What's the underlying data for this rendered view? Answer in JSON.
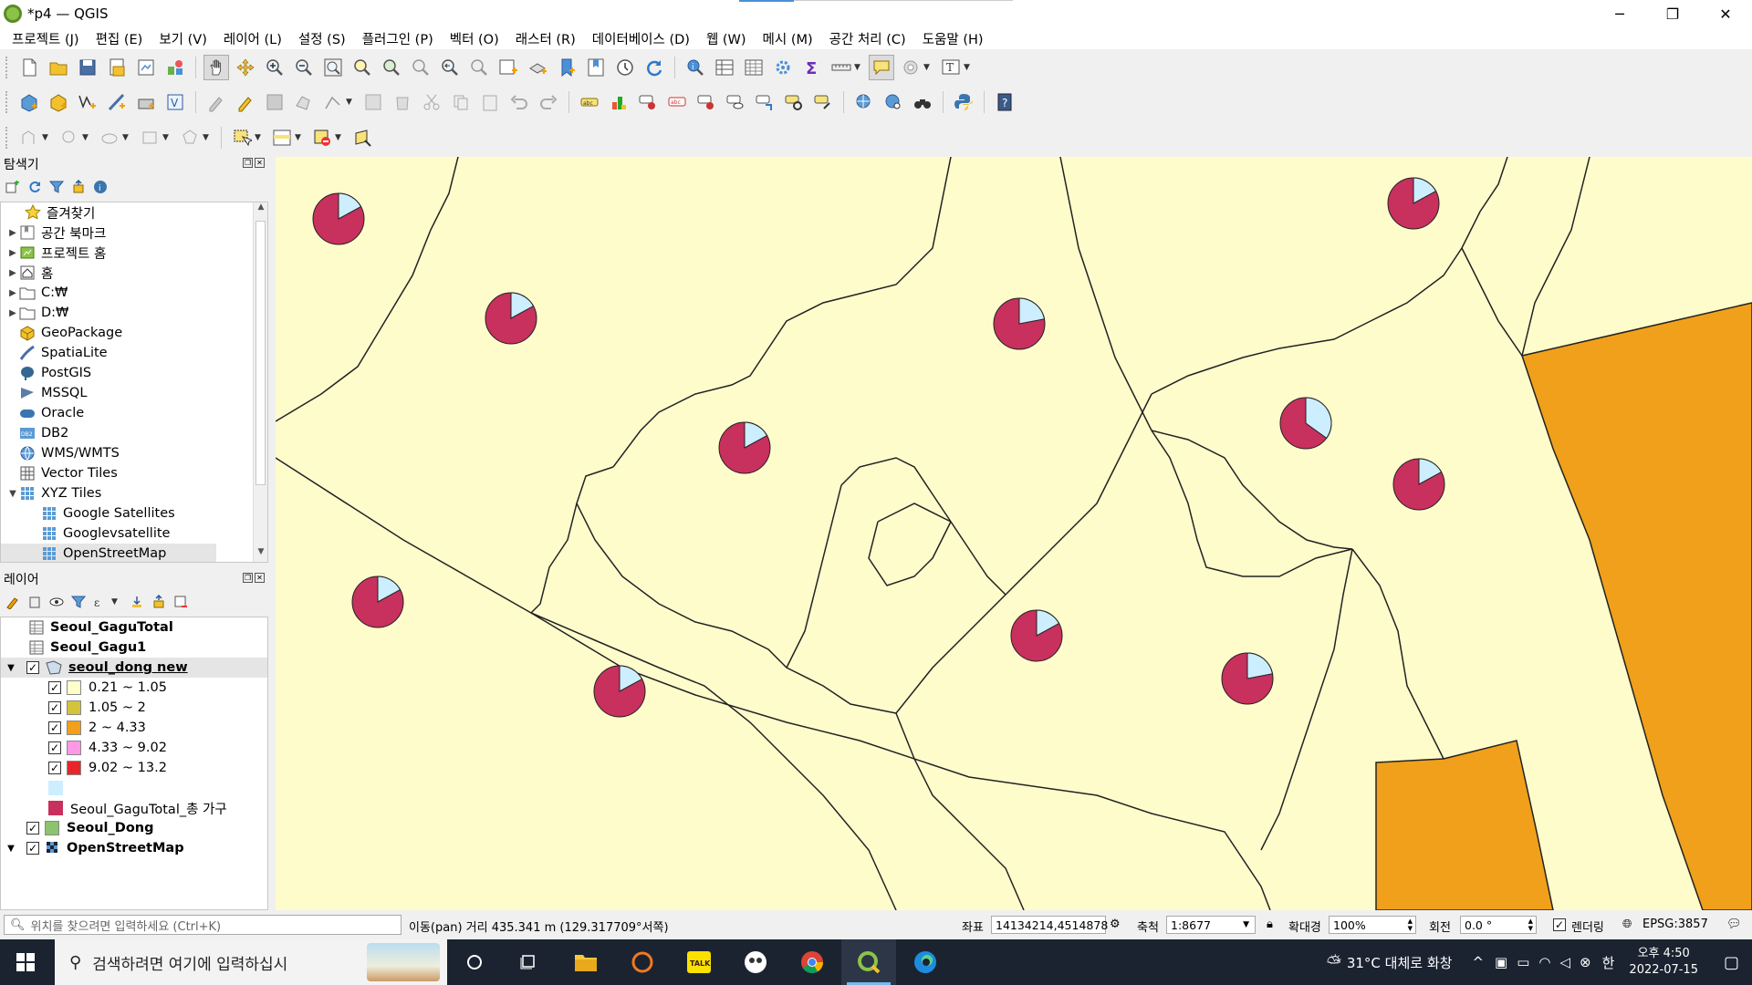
{
  "window": {
    "title": "*p4 — QGIS",
    "minimize": "─",
    "maximize": "❐",
    "close": "✕"
  },
  "menu": [
    "프로젝트 (J)",
    "편집 (E)",
    "보기 (V)",
    "레이어 (L)",
    "설정 (S)",
    "플러그인 (P)",
    "벡터 (O)",
    "래스터 (R)",
    "데이터베이스 (D)",
    "웹 (W)",
    "메시 (M)",
    "공간 처리 (C)",
    "도움말 (H)"
  ],
  "browser_panel": {
    "title": "탐색기",
    "items": [
      {
        "label": "즐겨찾기",
        "icon": "star-icon",
        "arrow": ""
      },
      {
        "label": "공간 북마크",
        "icon": "bookmark-icon",
        "arrow": "▶"
      },
      {
        "label": "프로젝트 홈",
        "icon": "project-home-icon",
        "arrow": "▶"
      },
      {
        "label": "홈",
        "icon": "home-icon",
        "arrow": "▶"
      },
      {
        "label": "C:₩",
        "icon": "folder-icon",
        "arrow": "▶"
      },
      {
        "label": "D:₩",
        "icon": "folder-icon",
        "arrow": "▶"
      },
      {
        "label": "GeoPackage",
        "icon": "geopackage-icon",
        "arrow": ""
      },
      {
        "label": "SpatiaLite",
        "icon": "spatialite-icon",
        "arrow": ""
      },
      {
        "label": "PostGIS",
        "icon": "postgis-icon",
        "arrow": ""
      },
      {
        "label": "MSSQL",
        "icon": "mssql-icon",
        "arrow": ""
      },
      {
        "label": "Oracle",
        "icon": "oracle-icon",
        "arrow": ""
      },
      {
        "label": "DB2",
        "icon": "db2-icon",
        "arrow": ""
      },
      {
        "label": "WMS/WMTS",
        "icon": "wms-icon",
        "arrow": ""
      },
      {
        "label": "Vector Tiles",
        "icon": "vector-tiles-icon",
        "arrow": ""
      },
      {
        "label": "XYZ Tiles",
        "icon": "xyz-tiles-icon",
        "arrow": "▼"
      },
      {
        "label": "Google Satellites",
        "icon": "xyz-tile-icon",
        "arrow": "",
        "child": true
      },
      {
        "label": "Googlevsatellite",
        "icon": "xyz-tile-icon",
        "arrow": "",
        "child": true
      },
      {
        "label": "OpenStreetMap",
        "icon": "xyz-tile-icon",
        "arrow": "",
        "child": true,
        "selected": true
      }
    ]
  },
  "layers_panel": {
    "title": "레이어",
    "layers": [
      {
        "label": "Seoul_GaguTotal",
        "type": "table",
        "checked": null,
        "bold": true
      },
      {
        "label": "Seoul_Gagu1",
        "type": "table",
        "checked": null,
        "bold": true
      },
      {
        "label": "seoul_dong new",
        "type": "polygon",
        "checked": true,
        "bold": true,
        "underline": true,
        "expanded": true
      },
      {
        "label": "0.21 ~ 1.05",
        "type": "class",
        "checked": true,
        "color": "#ffffcc"
      },
      {
        "label": "1.05 ~ 2",
        "type": "class",
        "checked": true,
        "color": "#d4c33a"
      },
      {
        "label": "2 ~ 4.33",
        "type": "class",
        "checked": true,
        "color": "#f0a01a"
      },
      {
        "label": "4.33 ~ 9.02",
        "type": "class",
        "checked": true,
        "color": "#ff99e6"
      },
      {
        "label": "9.02 ~ 13.2",
        "type": "class",
        "checked": true,
        "color": "#e8262a"
      },
      {
        "label": "",
        "type": "diagram",
        "color": "#cceeff"
      },
      {
        "label": "Seoul_GaguTotal_총 가구",
        "type": "diagram",
        "color": "#c8305e"
      },
      {
        "label": "Seoul_Dong",
        "type": "polygon",
        "checked": true,
        "bold": true,
        "color": "#8dc26f"
      },
      {
        "label": "OpenStreetMap",
        "type": "raster",
        "checked": true,
        "bold": true
      }
    ]
  },
  "map": {
    "pie_colors": {
      "main": "#c8305e",
      "secondary": "#cceeff"
    },
    "fill_light": "#fffccc",
    "fill_orange": "#f0a01a"
  },
  "statusbar": {
    "locator_placeholder": "위치를 찾으려면 입력하세요 (Ctrl+K)",
    "message": "이동(pan) 거리 435.341 m (129.317709°서쪽)",
    "coord_label": "좌표",
    "coord_value": "14134214,4514878",
    "scale_label": "축척",
    "scale_value": "1:8677",
    "magnifier_label": "확대경",
    "magnifier_value": "100%",
    "rotation_label": "회전",
    "rotation_value": "0.0 °",
    "render_label": "렌더링",
    "crs": "EPSG:3857"
  },
  "taskbar": {
    "search_placeholder": "검색하려면 여기에 입력하십시",
    "weather": "31°C 대체로 화창",
    "ime": "한",
    "time": "오후 4:50",
    "date": "2022-07-15"
  }
}
